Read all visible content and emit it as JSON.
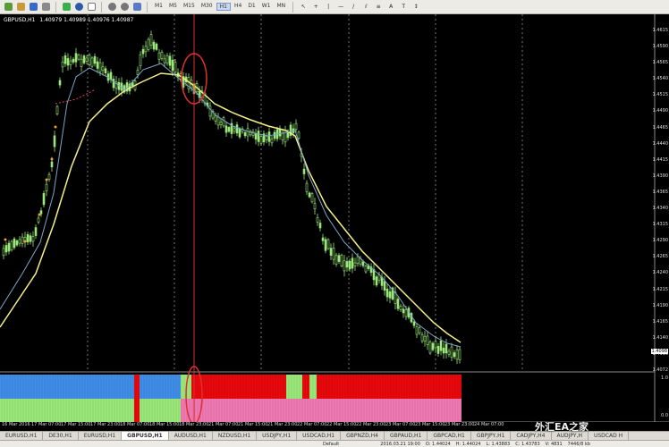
{
  "toolbar": {
    "timeframes": [
      "M1",
      "M5",
      "M15",
      "M30",
      "H1",
      "H4",
      "D1",
      "W1",
      "MN"
    ],
    "selected_timeframe": "H1"
  },
  "chart": {
    "symbol_label": "GBPUSD,H1",
    "ohlc": "1.40979 1.40989 1.40976 1.40987",
    "price_labels": [
      "1.4615",
      "1.4590",
      "1.4565",
      "1.4540",
      "1.4515",
      "1.4490",
      "1.4465",
      "1.4440",
      "1.4415",
      "1.4390",
      "1.4365",
      "1.4340",
      "1.4315",
      "1.4290",
      "1.4265",
      "1.4240",
      "1.4215",
      "1.4190",
      "1.4165",
      "1.4140",
      "1.4115",
      "1.4098",
      "1.4072"
    ],
    "current_price": "1.4098",
    "time_labels": [
      "16 Mar 2016",
      "17 Mar 07:00",
      "17 Mar 15:00",
      "17 Mar 23:00",
      "18 Mar 07:00",
      "18 Mar 15:00",
      "18 Mar 23:00",
      "21 Mar 07:00",
      "21 Mar 15:00",
      "21 Mar 23:00",
      "22 Mar 07:00",
      "22 Mar 15:00",
      "22 Mar 23:00",
      "23 Mar 07:00",
      "23 Mar 15:00",
      "23 Mar 23:00",
      "24 Mar 07:00"
    ],
    "sub_labels": [
      "1.0",
      "0.0"
    ],
    "colors": {
      "bull": "#9be87a",
      "ma_yellow": "#f5f08a",
      "ma_blue": "#7aa5c9",
      "ma_red": "#d9485f",
      "vline": "#e03030",
      "sub_blue": "#3f8ee8",
      "sub_red": "#e8090d",
      "sub_green": "#9be87a",
      "sub_pink": "#f07ab4"
    }
  },
  "tabs": [
    "EURUSD,H1",
    "DE30,H1",
    "EURUSD,H1",
    "GBPUSD,H1",
    "AUDUSD,H1",
    "NZDUSD,H1",
    "USDJPY,H1",
    "USDCAD,H1",
    "GBPNZD,H4",
    "GBPAUD,H1",
    "GBPCAD,H1",
    "GBPJPY,H1",
    "CADJPY,H4",
    "AUDJPY,H",
    "USDCAD H"
  ],
  "active_tab": 3,
  "status": {
    "profile": "Default",
    "datetime": "2016.03.21 19:00",
    "open": "O: 1.44024",
    "high": "H: 1.44024",
    "low": "L: 1.43883",
    "close": "C: 1.43783",
    "volume": "V: 4831",
    "traffic": "7446/8 kb"
  },
  "watermark": "外汇EA之家"
}
